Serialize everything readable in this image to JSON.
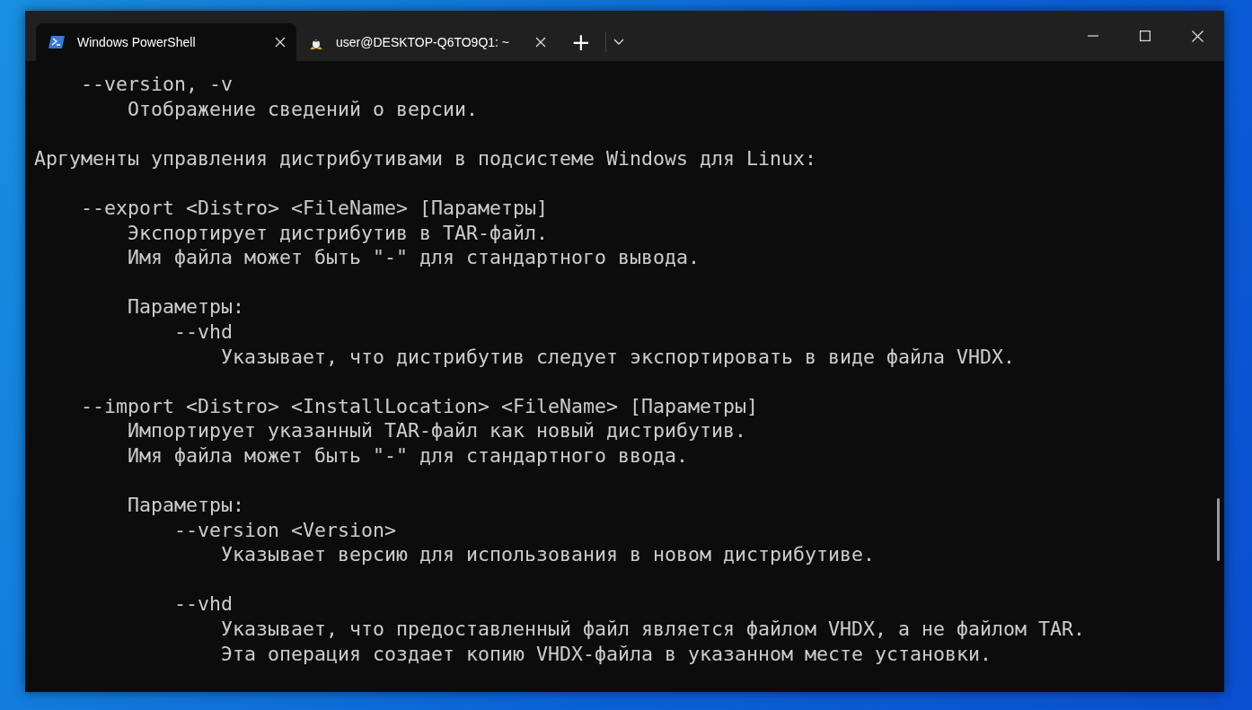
{
  "tabs": [
    {
      "title": "Windows PowerShell",
      "kind": "powershell",
      "selected": true
    },
    {
      "title": "user@DESKTOP-Q6TO9Q1: ~",
      "kind": "linux",
      "selected": false
    }
  ],
  "new_tab_button": "+",
  "terminal": {
    "blocks": [
      [
        "    --version, -v",
        "        Отображение сведений о версии."
      ],
      [
        "Аргументы управления дистрибутивами в подсистеме Windows для Linux:"
      ],
      [
        "    --export <Distro> <FileName> [Параметры]",
        "        Экспортирует дистрибутив в TAR-файл.",
        "        Имя файла может быть \"-\" для стандартного вывода."
      ],
      [
        "        Параметры:",
        "            --vhd",
        "                Указывает, что дистрибутив следует экспортировать в виде файла VHDX."
      ],
      [
        "    --import <Distro> <InstallLocation> <FileName> [Параметры]",
        "        Импортирует указанный TAR-файл как новый дистрибутив.",
        "        Имя файла может быть \"-\" для стандартного ввода."
      ],
      [
        "        Параметры:",
        "            --version <Version>",
        "                Указывает версию для использования в новом дистрибутиве."
      ],
      [
        "            --vhd",
        "                Указывает, что предоставленный файл является файлом VHDX, а не файлом TAR.",
        "                Эта операция создает копию VHDX-файла в указанном месте установки."
      ]
    ]
  }
}
